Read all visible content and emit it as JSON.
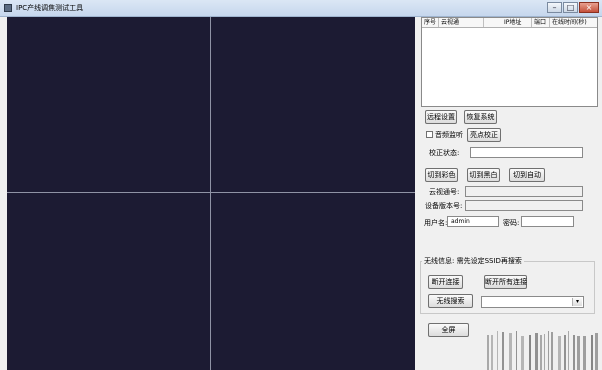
{
  "window": {
    "title": "IPC产线调焦测试工具",
    "minimize_glyph": "–",
    "maximize_glyph": "□",
    "close_glyph": "×"
  },
  "video_grid": {
    "cells": [
      "video-cell-1",
      "video-cell-2",
      "video-cell-3",
      "video-cell-4"
    ],
    "background_color": "#1c1b33",
    "divider_color": "#8f93a5"
  },
  "device_table": {
    "columns": [
      "序号",
      "云视通",
      "IP地址",
      "端口",
      "在线时间(秒)"
    ],
    "rows": []
  },
  "controls": {
    "remote_settings": "远程设置",
    "restore_system": "恢复系统",
    "audio_monitor": "音频监听",
    "bright_spot_calibration": "亮点校正",
    "calibration_status_label": "校正状态:",
    "calibration_status_value": "",
    "switch_color": "切到彩色",
    "switch_bw": "切到黑白",
    "switch_auto": "切到自动",
    "cloud_id_label": "云视通号:",
    "cloud_id_value": "",
    "device_version_label": "设备版本号:",
    "device_version_value": "",
    "username_label": "用户名:",
    "username_value": "admin",
    "password_label": "密码:",
    "password_value": ""
  },
  "wireless": {
    "group_title": "无线信息: 需先设定SSID再搜索",
    "disconnect": "断开连接",
    "disconnect_all": "断开所有连接",
    "wireless_search": "无线搜索",
    "ssid_selected": "",
    "dropdown_glyph": "▾"
  },
  "fullscreen": "全屏",
  "icons": {
    "app_icon": "app-icon",
    "combo_arrow": "chevron-down-icon",
    "barcode": "barcode-icon"
  }
}
